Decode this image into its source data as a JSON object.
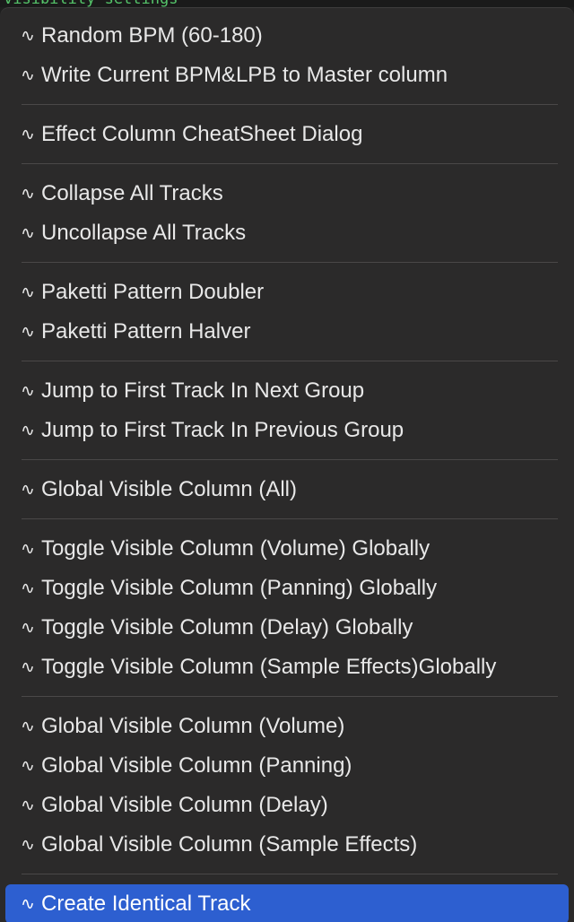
{
  "background_code_text": "visibility settings",
  "menu": {
    "glyph": "∿",
    "groups": [
      {
        "items": [
          {
            "label": "Random BPM (60-180)"
          },
          {
            "label": "Write Current BPM&LPB to Master column"
          }
        ]
      },
      {
        "items": [
          {
            "label": "Effect Column CheatSheet Dialog"
          }
        ]
      },
      {
        "items": [
          {
            "label": "Collapse All Tracks"
          },
          {
            "label": "Uncollapse All Tracks"
          }
        ]
      },
      {
        "items": [
          {
            "label": "Paketti Pattern Doubler"
          },
          {
            "label": "Paketti Pattern Halver"
          }
        ]
      },
      {
        "items": [
          {
            "label": "Jump to First Track In Next Group"
          },
          {
            "label": "Jump to First Track In Previous Group"
          }
        ]
      },
      {
        "items": [
          {
            "label": "Global Visible Column (All)"
          }
        ]
      },
      {
        "items": [
          {
            "label": "Toggle Visible Column (Volume) Globally"
          },
          {
            "label": "Toggle Visible Column (Panning) Globally"
          },
          {
            "label": "Toggle Visible Column (Delay) Globally"
          },
          {
            "label": "Toggle Visible Column (Sample Effects)Globally"
          }
        ]
      },
      {
        "items": [
          {
            "label": "Global Visible Column (Volume)"
          },
          {
            "label": "Global Visible Column (Panning)"
          },
          {
            "label": "Global Visible Column (Delay)"
          },
          {
            "label": "Global Visible Column (Sample Effects)"
          }
        ]
      },
      {
        "items": [
          {
            "label": "Create Identical Track",
            "selected": true
          }
        ]
      }
    ]
  },
  "colors": {
    "menu_background": "#2b2a2a",
    "text": "#e8e8e8",
    "separator": "#4a4848",
    "selection": "#2d5fd0",
    "code_text": "#55c46a"
  }
}
